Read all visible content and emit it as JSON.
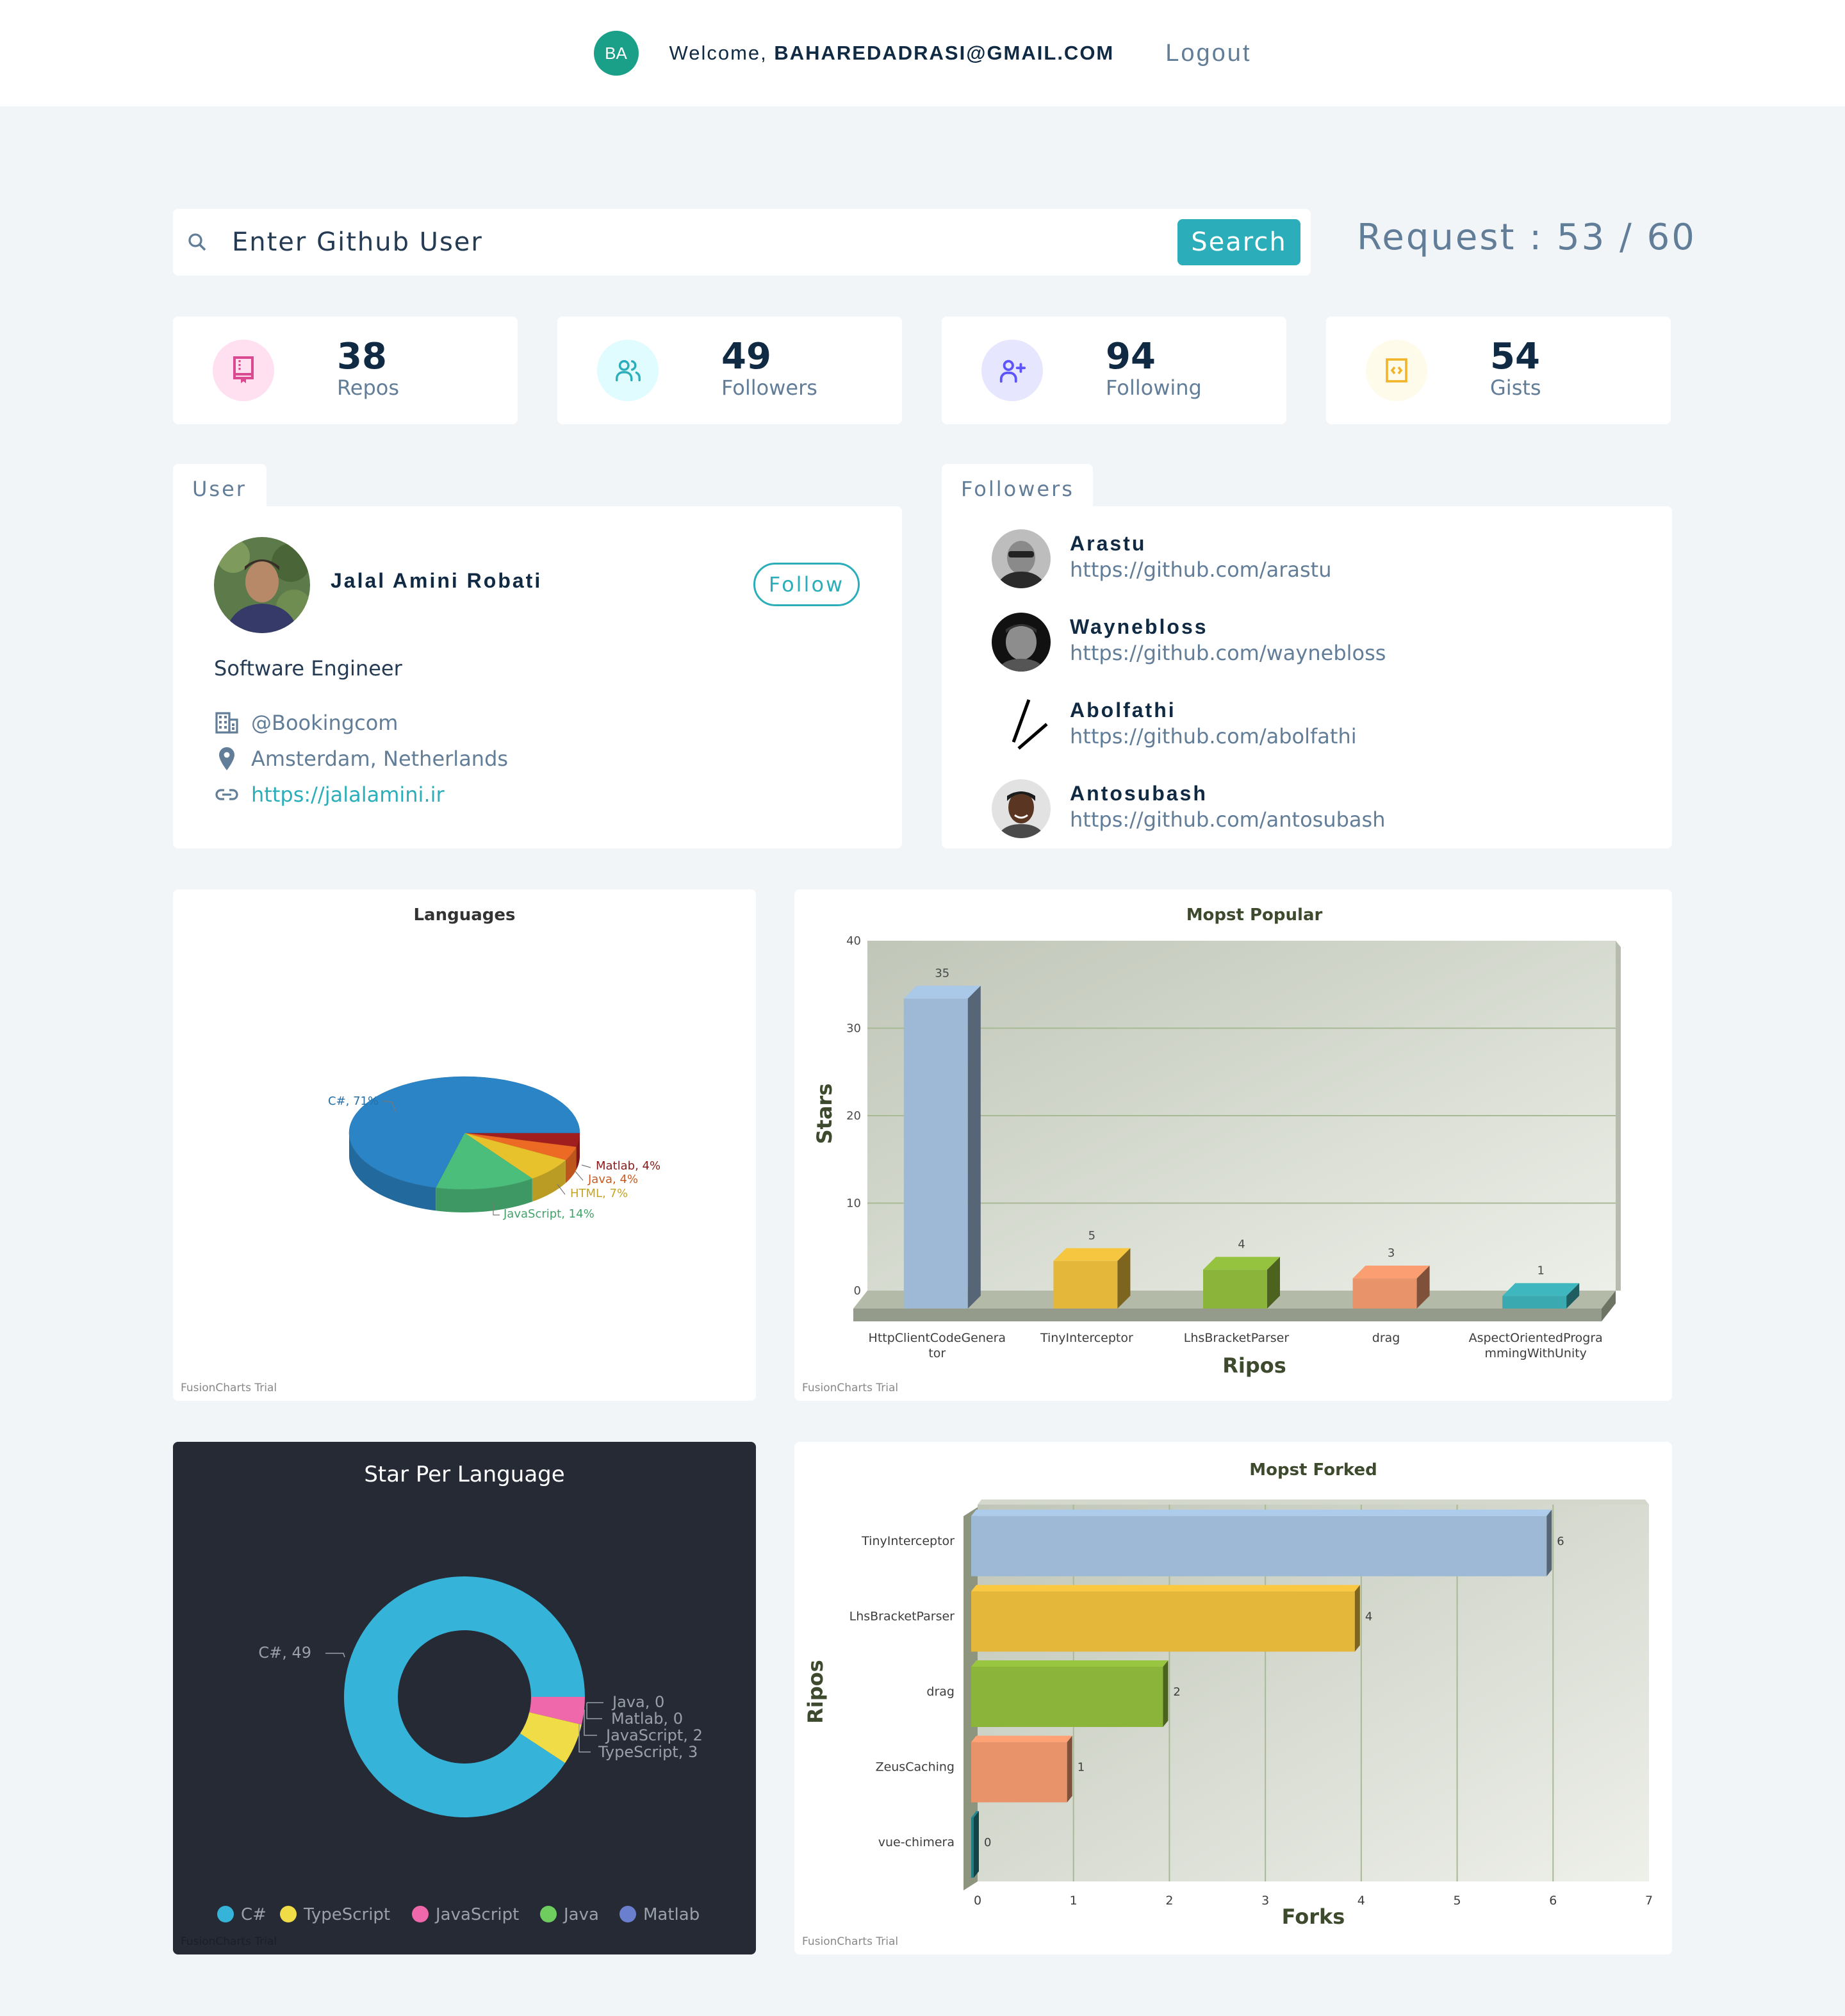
{
  "nav": {
    "avatar_initials": "BA",
    "welcome_prefix": "Welcome, ",
    "user_email": "BAHAREDADRASI@GMAIL.COM",
    "logout_label": "Logout"
  },
  "search": {
    "placeholder": "Enter Github User",
    "value": "",
    "button_label": "Search",
    "icon": "search-icon"
  },
  "requests": {
    "label": "Request : 53 / 60",
    "used": 53,
    "total": 60
  },
  "stats": [
    {
      "value": "38",
      "label": "Repos",
      "icon": "repo-book-icon",
      "color": "#da4a91",
      "bg": "#ffe0f0"
    },
    {
      "value": "49",
      "label": "Followers",
      "icon": "users-icon",
      "color": "#2caeba",
      "bg": "#e0fcff"
    },
    {
      "value": "94",
      "label": "Following",
      "icon": "user-plus-icon",
      "color": "#5d55fa",
      "bg": "#e6e6ff"
    },
    {
      "value": "54",
      "label": "Gists",
      "icon": "code-file-icon",
      "color": "#f0b429",
      "bg": "#fffbea"
    }
  ],
  "user_card": {
    "tab_label": "User",
    "name": "Jalal Amini Robati",
    "follow_label": "Follow",
    "bio": "Software Engineer",
    "company": "@Bookingcom",
    "location": "Amsterdam, Netherlands",
    "blog": "https://jalalamini.ir"
  },
  "followers_card": {
    "tab_label": "Followers",
    "items": [
      {
        "name": "Arastu",
        "url": "https://github.com/arastu"
      },
      {
        "name": "Waynebloss",
        "url": "https://github.com/waynebloss"
      },
      {
        "name": "Abolfathi",
        "url": "https://github.com/abolfathi"
      },
      {
        "name": "Antosubash",
        "url": "https://github.com/antosubash"
      }
    ]
  },
  "watermark": "FusionCharts Trial",
  "chart_data": [
    {
      "id": "languages",
      "type": "pie",
      "style": "3d",
      "title": "Languages",
      "slices": [
        {
          "label": "C#",
          "value": 71,
          "display": "C#, 71%",
          "color": "#2b84c6"
        },
        {
          "label": "JavaScript",
          "value": 14,
          "display": "JavaScript, 14%",
          "color": "#4cbe7c"
        },
        {
          "label": "HTML",
          "value": 7,
          "display": "HTML, 7%",
          "color": "#e8c22c"
        },
        {
          "label": "Java",
          "value": 4,
          "display": "Java, 4%",
          "color": "#ec6a24"
        },
        {
          "label": "Matlab",
          "value": 4,
          "display": "Matlab, 4%",
          "color": "#a01e1e"
        }
      ]
    },
    {
      "id": "most_popular",
      "type": "bar",
      "style": "3d-column",
      "title": "Mopst Popular",
      "xlabel": "Ripos",
      "ylabel": "Stars",
      "ylim": [
        0,
        40
      ],
      "yticks": [
        0,
        10,
        20,
        30,
        40
      ],
      "grid": true,
      "categories": [
        "HttpClientCodeGenerator",
        "TinyInterceptor",
        "LhsBracketParser",
        "drag",
        "AspectOrientedProgrammingWithUnity"
      ],
      "category_lines": [
        [
          "HttpClientCodeGenera",
          "tor"
        ],
        [
          "TinyInterceptor"
        ],
        [
          "LhsBracketParser"
        ],
        [
          "drag"
        ],
        [
          "AspectOrientedProgra",
          "mmingWithUnity"
        ]
      ],
      "values": [
        35,
        5,
        4,
        3,
        1
      ],
      "colors": [
        "#9db9d6",
        "#e4b73b",
        "#8ab43a",
        "#e8936a",
        "#3aa9b0"
      ]
    },
    {
      "id": "star_per_language",
      "type": "pie",
      "style": "doughnut",
      "title": "Star Per Language",
      "slices": [
        {
          "label": "C#",
          "value": 49,
          "display": "C#, 49",
          "color": "#36b3d8"
        },
        {
          "label": "TypeScript",
          "value": 3,
          "display": "TypeScript, 3",
          "color": "#f0dc46"
        },
        {
          "label": "JavaScript",
          "value": 2,
          "display": "JavaScript, 2",
          "color": "#ef68ac"
        },
        {
          "label": "Java",
          "value": 0,
          "display": "Java, 0",
          "color": "#6fcc5e"
        },
        {
          "label": "Matlab",
          "value": 0,
          "display": "Matlab, 0",
          "color": "#6b7fcf"
        }
      ],
      "legend": "bottom"
    },
    {
      "id": "most_forked",
      "type": "bar",
      "style": "3d-horizontal",
      "title": "Mopst Forked",
      "xlabel": "Forks",
      "ylabel": "Ripos",
      "xlim": [
        0,
        7
      ],
      "xticks": [
        0,
        1,
        2,
        3,
        4,
        5,
        6,
        7
      ],
      "grid": true,
      "categories": [
        "TinyInterceptor",
        "LhsBracketParser",
        "drag",
        "ZeusCaching",
        "vue-chimera"
      ],
      "values": [
        6,
        4,
        2,
        1,
        0
      ],
      "colors": [
        "#9db9d6",
        "#e4b73b",
        "#8ab43a",
        "#e8936a",
        "#1f7d83"
      ]
    }
  ]
}
